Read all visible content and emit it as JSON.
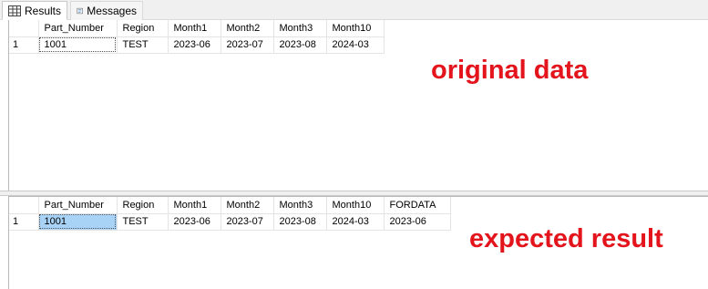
{
  "tabs": [
    {
      "label": "Results",
      "icon": "grid-icon"
    },
    {
      "label": "Messages",
      "icon": "messages-icon"
    }
  ],
  "top_grid": {
    "columns": [
      "",
      "Part_Number",
      "Region",
      "Month1",
      "Month2",
      "Month3",
      "Month10"
    ],
    "rows": [
      [
        "1",
        "1001",
        "TEST",
        "2023-06",
        "2023-07",
        "2023-08",
        "2024-03"
      ]
    ]
  },
  "bottom_grid": {
    "columns": [
      "",
      "Part_Number",
      "Region",
      "Month1",
      "Month2",
      "Month3",
      "Month10",
      "FORDATA"
    ],
    "rows": [
      [
        "1",
        "1001",
        "TEST",
        "2023-06",
        "2023-07",
        "2023-08",
        "2024-03",
        "2023-06"
      ]
    ]
  },
  "annotations": {
    "top": "original data",
    "bottom": "expected result"
  },
  "colors": {
    "annotation": "#e3141b",
    "selection": "#a8d3f7"
  }
}
